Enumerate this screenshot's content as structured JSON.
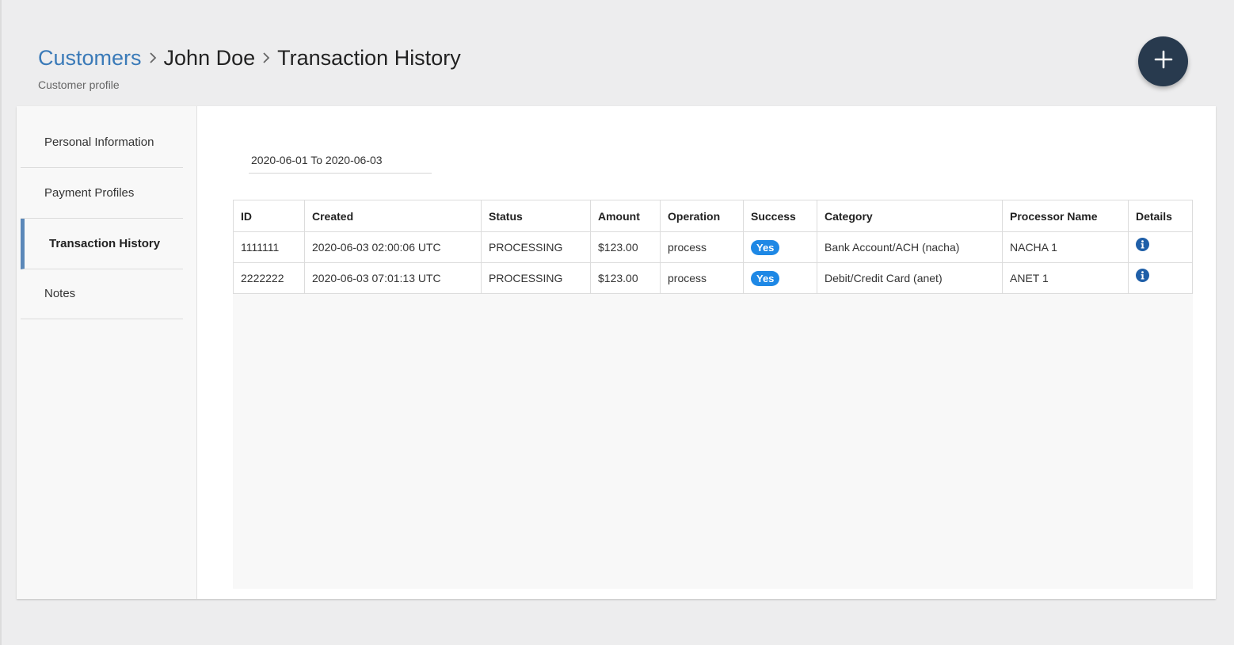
{
  "breadcrumb": {
    "customers": "Customers",
    "customer_name": "John Doe",
    "current": "Transaction History"
  },
  "subtitle": "Customer profile",
  "fab_icon": "plus-icon",
  "sidebar": {
    "items": [
      {
        "label": "Personal Information"
      },
      {
        "label": "Payment Profiles"
      },
      {
        "label": "Transaction History"
      },
      {
        "label": "Notes"
      }
    ],
    "active": "Transaction History"
  },
  "date_range": "2020-06-01 To 2020-06-03",
  "table": {
    "headers": [
      "ID",
      "Created",
      "Status",
      "Amount",
      "Operation",
      "Success",
      "Category",
      "Processor Name",
      "Details"
    ],
    "rows": [
      {
        "id": "1111111",
        "created": "2020-06-03 02:00:06 UTC",
        "status": "PROCESSING",
        "amount": "$123.00",
        "operation": "process",
        "success": "Yes",
        "category": "Bank Account/ACH (nacha)",
        "processor": "NACHA 1",
        "details_icon": "info-circle-icon"
      },
      {
        "id": "2222222",
        "created": "2020-06-03 07:01:13 UTC",
        "status": "PROCESSING",
        "amount": "$123.00",
        "operation": "process",
        "success": "Yes",
        "category": "Debit/Credit Card (anet)",
        "processor": "ANET 1",
        "details_icon": "info-circle-icon"
      }
    ]
  },
  "colors": {
    "link": "#3a7ab8",
    "fab": "#283a4e",
    "badge": "#1e88e5",
    "active_indicator": "#5b88b9",
    "info_icon": "#1f5fa8"
  }
}
